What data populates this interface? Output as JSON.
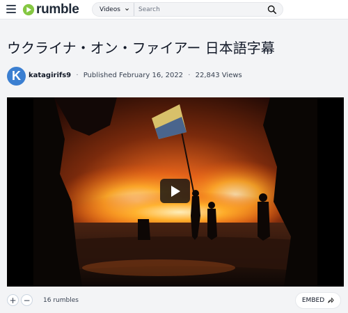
{
  "header": {
    "logo_text": "rumble",
    "category": "Videos",
    "search_placeholder": "Search"
  },
  "video": {
    "title": "ウクライナ・オン・ファイアー 日本語字幕",
    "channel_initial": "K",
    "channel_name": "katagirifs9",
    "published": "Published February 16, 2022",
    "views": "22,843 Views"
  },
  "actions": {
    "rumble_up": "+",
    "rumble_down": "−",
    "rumbles": "16 rumbles",
    "embed_label": "EMBED"
  },
  "colors": {
    "brand_green": "#85c742",
    "avatar_blue": "#3b7fd1"
  },
  "icons": [
    "menu-icon",
    "rumble-logo-icon",
    "chevron-down-icon",
    "search-icon",
    "play-icon",
    "share-arrow-icon"
  ]
}
